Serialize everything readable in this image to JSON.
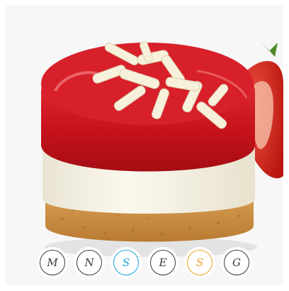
{
  "image": {
    "alt": "",
    "colors": {
      "background": "#f7f7f7",
      "jelly": "#c8121c",
      "cream": "#f4f0e2",
      "crust": "#d39545",
      "chocolate": "#f7f1dc",
      "strawberry": "#d7261e"
    }
  },
  "swatches": [
    {
      "letter": "M",
      "color": "#3a3a3a",
      "border": "#3a3a3a"
    },
    {
      "letter": "N",
      "color": "#3a3a3a",
      "border": "#3a3a3a"
    },
    {
      "letter": "S",
      "color": "#1aa3d8",
      "border": "#1aa3d8"
    },
    {
      "letter": "E",
      "color": "#3a3a3a",
      "border": "#3a3a3a"
    },
    {
      "letter": "S",
      "color": "#e3a421",
      "border": "#e3a421"
    },
    {
      "letter": "G",
      "color": "#3a3a3a",
      "border": "#3a3a3a"
    }
  ]
}
